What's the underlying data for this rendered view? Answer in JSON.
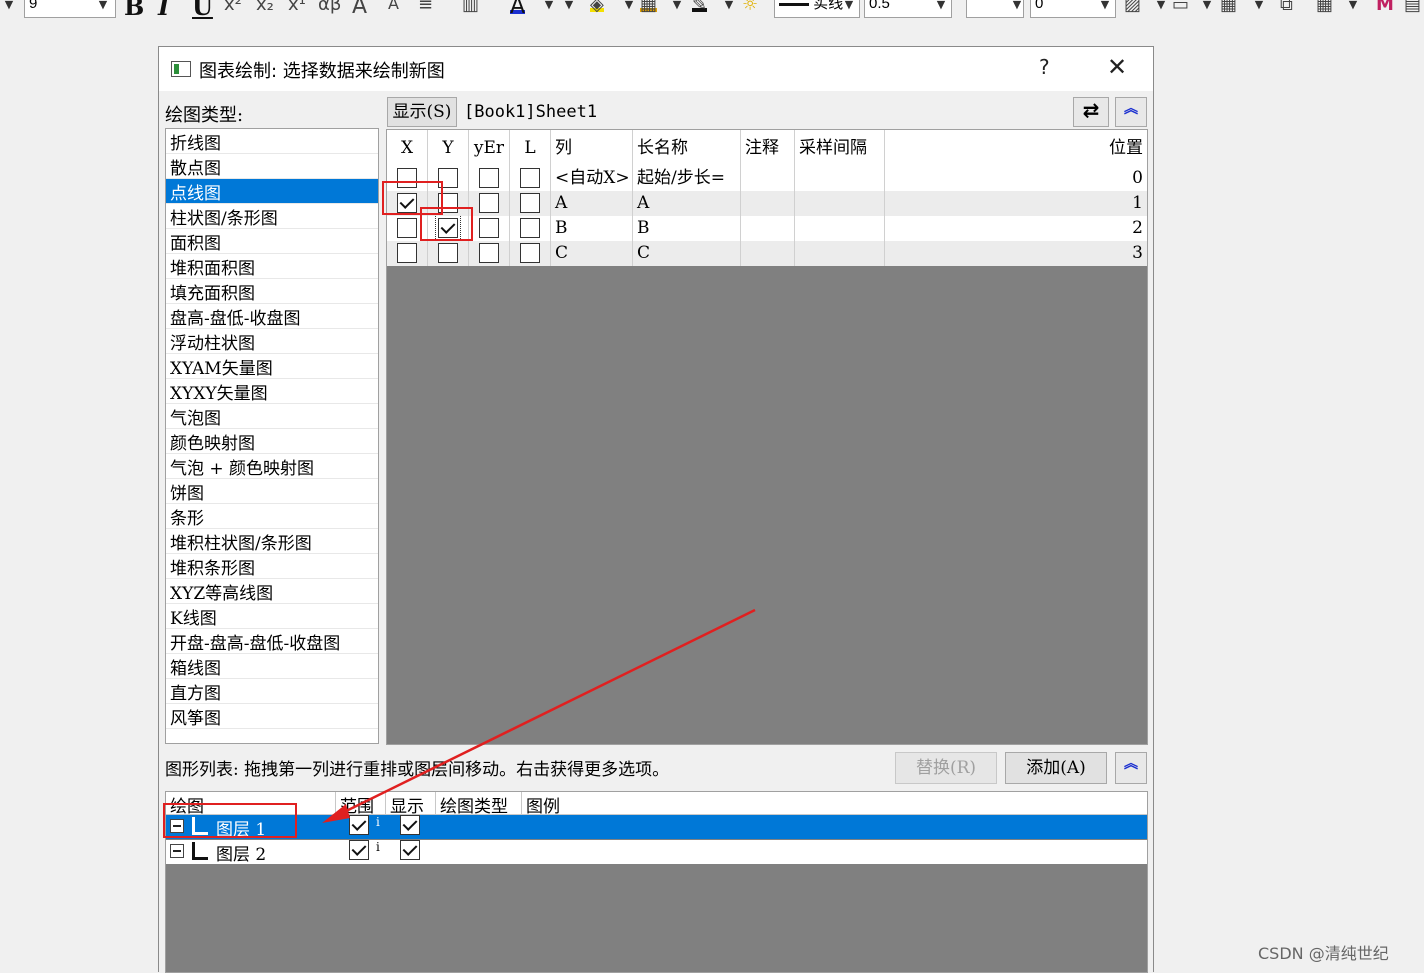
{
  "toolbar": {
    "font_size": "9",
    "line_style": "实线",
    "line_width": "0.5",
    "value_field": "0"
  },
  "dialog": {
    "title": "图表绘制: 选择数据来绘制新图",
    "help_label": "?",
    "close_label": "✕"
  },
  "plot_type": {
    "label": "绘图类型:",
    "items": [
      "折线图",
      "散点图",
      "点线图",
      "柱状图/条形图",
      "面积图",
      "堆积面积图",
      "填充面积图",
      "盘高-盘低-收盘图",
      "浮动柱状图",
      "XYAM矢量图",
      "XYXY矢量图",
      "气泡图",
      "颜色映射图",
      "气泡 + 颜色映射图",
      "饼图",
      "条形",
      "堆积柱状图/条形图",
      "堆积条形图",
      "XYZ等高线图",
      "K线图",
      "开盘-盘高-盘低-收盘图",
      "箱线图",
      "直方图",
      "风筝图"
    ],
    "selected_index": 2
  },
  "source": {
    "show_button": "显示(S)",
    "name": "[Book1]Sheet1"
  },
  "columns": {
    "headers": [
      "X",
      "Y",
      "yEr",
      "L",
      "列",
      "长名称",
      "注释",
      "采样间隔",
      "位置"
    ],
    "rows": [
      {
        "x": false,
        "y": false,
        "yerr": false,
        "l": false,
        "col": "<自动X>",
        "long_name": "起始/步长=",
        "comment": "",
        "sampling": "",
        "position": "0"
      },
      {
        "x": true,
        "y": false,
        "yerr": false,
        "l": false,
        "col": "A",
        "long_name": "A",
        "comment": "",
        "sampling": "",
        "position": "1"
      },
      {
        "x": false,
        "y": true,
        "yerr": false,
        "l": false,
        "col": "B",
        "long_name": "B",
        "comment": "",
        "sampling": "",
        "position": "2"
      },
      {
        "x": false,
        "y": false,
        "yerr": false,
        "l": false,
        "col": "C",
        "long_name": "C",
        "comment": "",
        "sampling": "",
        "position": "3"
      }
    ]
  },
  "plot_list": {
    "hint": "图形列表: 拖拽第一列进行重排或图层间移动。右击获得更多选项。",
    "replace_button": "替换(R)",
    "add_button": "添加(A)",
    "headers": [
      "绘图",
      "范围",
      "显示",
      "绘图类型",
      "图例"
    ],
    "layers": [
      {
        "name": "图层 1",
        "range_checked": true,
        "range_text": "i",
        "show_checked": true
      },
      {
        "name": "图层 2",
        "range_checked": true,
        "range_text": "i",
        "show_checked": true
      }
    ]
  },
  "colors": {
    "selection": "#0078d7",
    "annotation": "#e02020",
    "grid_background": "#808080"
  },
  "watermark": "CSDN @清纯世纪"
}
